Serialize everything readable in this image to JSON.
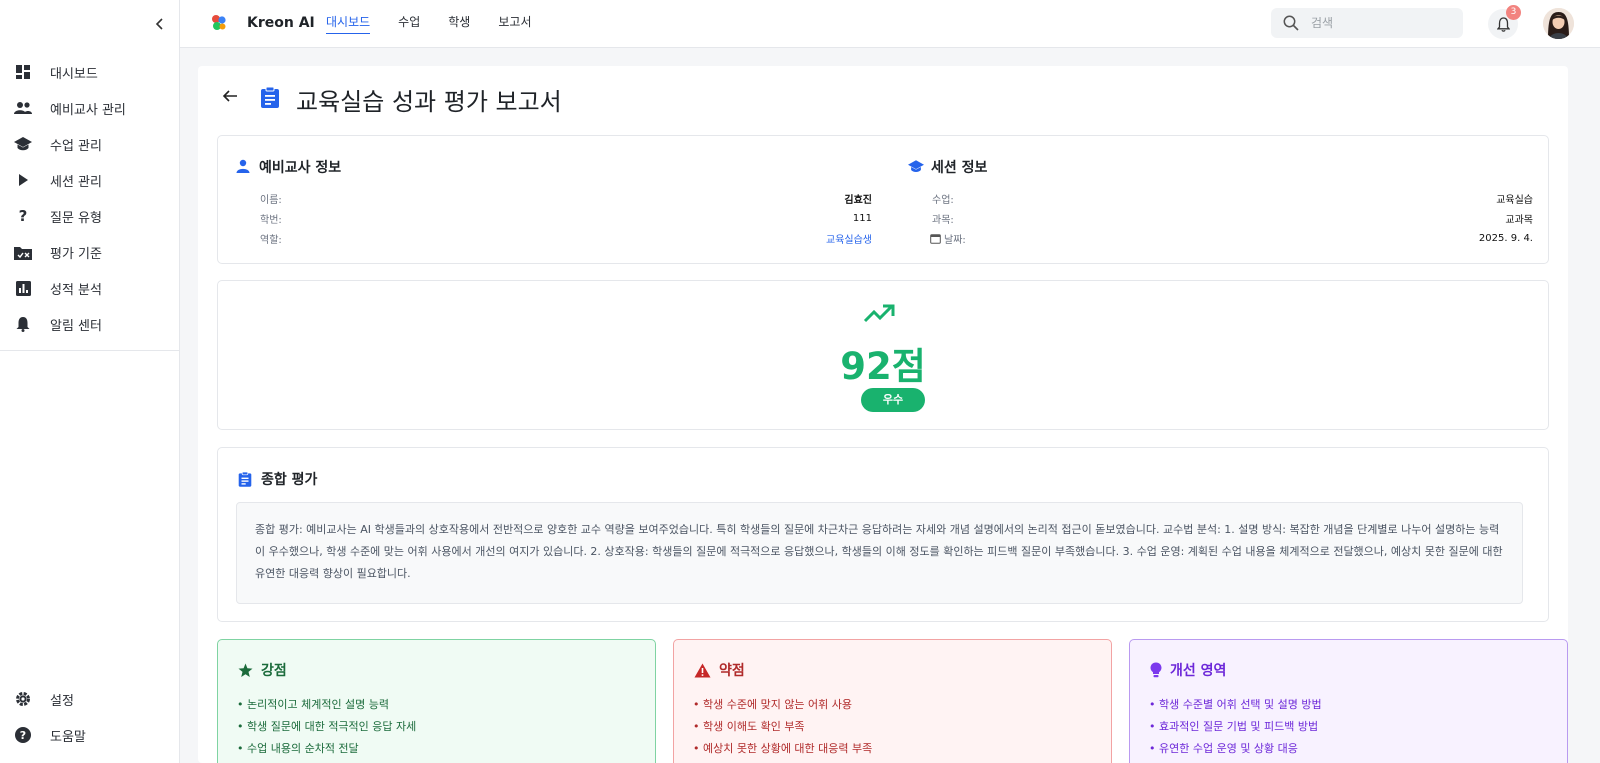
{
  "sidebar": {
    "items": [
      {
        "label": "대시보드",
        "icon": "dashboard-icon"
      },
      {
        "label": "예비교사 관리",
        "icon": "people-icon"
      },
      {
        "label": "수업 관리",
        "icon": "school-icon"
      },
      {
        "label": "세션 관리",
        "icon": "play-icon"
      },
      {
        "label": "질문 유형",
        "icon": "question-icon"
      },
      {
        "label": "평가 기준",
        "icon": "rule-folder-icon"
      },
      {
        "label": "성적 분석",
        "icon": "bar-chart-icon"
      },
      {
        "label": "알림 센터",
        "icon": "bell-icon"
      }
    ],
    "bottom": [
      {
        "label": "설정",
        "icon": "gear-icon"
      },
      {
        "label": "도움말",
        "icon": "help-icon"
      }
    ]
  },
  "header": {
    "brand": "Kreon AI",
    "nav": [
      {
        "label": "대시보드",
        "active": true
      },
      {
        "label": "수업",
        "active": false
      },
      {
        "label": "학생",
        "active": false
      },
      {
        "label": "보고서",
        "active": false
      }
    ],
    "search_placeholder": "검색",
    "notification_count": "3"
  },
  "page": {
    "title": "교육실습 성과 평가 보고서"
  },
  "teacher_info": {
    "heading": "예비교사 정보",
    "rows": [
      {
        "label": "이름:",
        "value": "김효진"
      },
      {
        "label": "학번:",
        "value": "111"
      },
      {
        "label": "역할:",
        "value": "교육실습생"
      }
    ]
  },
  "session_info": {
    "heading": "세션 정보",
    "rows": [
      {
        "label": "수업:",
        "value": "교육실습"
      },
      {
        "label": "과목:",
        "value": "교과목"
      },
      {
        "label": "날짜:",
        "value": "2025. 9. 4."
      }
    ]
  },
  "score": {
    "value": "92점",
    "grade": "우수",
    "color": "#19b26e"
  },
  "summary": {
    "heading": "종합 평가",
    "text": "종합 평가: 예비교사는 AI 학생들과의 상호작용에서 전반적으로 양호한 교수 역량을 보여주었습니다. 특히 학생들의 질문에 차근차근 응답하려는 자세와 개념 설명에서의 논리적 접근이 돋보였습니다. 교수법 분석: 1. 설명 방식: 복잡한 개념을 단계별로 나누어 설명하는 능력이 우수했으나, 학생 수준에 맞는 어휘 사용에서 개선의 여지가 있습니다. 2. 상호작용: 학생들의 질문에 적극적으로 응답했으나, 학생들의 이해 정도를 확인하는 피드백 질문이 부족했습니다. 3. 수업 운영: 계획된 수업 내용을 체계적으로 전달했으나, 예상치 못한 질문에 대한 유연한 대응력 향상이 필요합니다."
  },
  "strengths": {
    "heading": "강점",
    "items": [
      "• 논리적이고 체계적인 설명 능력",
      "• 학생 질문에 대한 적극적인 응답 자세",
      "• 수업 내용의 순차적 전달"
    ]
  },
  "weaknesses": {
    "heading": "약점",
    "items": [
      "• 학생 수준에 맞지 않는 어휘 사용",
      "• 학생 이해도 확인 부족",
      "• 예상치 못한 상황에 대한 대응력 부족"
    ]
  },
  "improvements": {
    "heading": "개선 영역",
    "items": [
      "• 학생 수준별 어휘 선택 및 설명 방법",
      "• 효과적인 질문 기법 및 피드백 방법",
      "• 유연한 수업 운영 및 상황 대응"
    ]
  }
}
